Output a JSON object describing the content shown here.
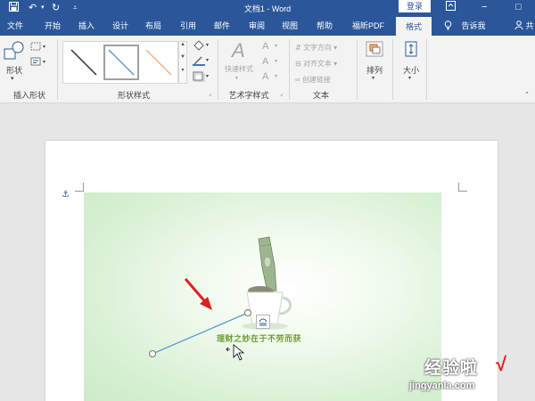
{
  "titlebar": {
    "doc_title": "文档1 - Word",
    "login_label": "登录",
    "colors": {
      "bar": "#2b579a",
      "tab_active_bg": "#f3f3f3"
    }
  },
  "tabs": [
    {
      "label": "文件"
    },
    {
      "label": "开始"
    },
    {
      "label": "插入"
    },
    {
      "label": "设计"
    },
    {
      "label": "布局"
    },
    {
      "label": "引用"
    },
    {
      "label": "邮件"
    },
    {
      "label": "审阅"
    },
    {
      "label": "视图"
    },
    {
      "label": "帮助"
    },
    {
      "label": "福昕PDF"
    },
    {
      "label": "格式",
      "active": true
    }
  ],
  "tell_me": "告诉我",
  "share_label": "共",
  "ribbon": {
    "insert_shapes": {
      "shape_label": "形状",
      "group_label": "插入形状"
    },
    "shape_styles": {
      "group_label": "形状样式",
      "swatch_colors": [
        "#333333",
        "#5b9bd5",
        "#f4b183"
      ]
    },
    "wordart": {
      "quick_styles": "快速样式",
      "group_label": "艺术字样式",
      "letter": "A"
    },
    "text": {
      "direction": "文字方向",
      "align": "对齐文本",
      "link": "创建链接",
      "group_label": "文本"
    },
    "arrange": {
      "label": "排列"
    },
    "size": {
      "label": "大小"
    }
  },
  "document": {
    "anchor_icon": "anchor-icon",
    "caption": "理财之妙在于不劳而获",
    "watermark_cn": "经验啦",
    "watermark_url": "jingyanla.com",
    "checkmark": "√"
  }
}
